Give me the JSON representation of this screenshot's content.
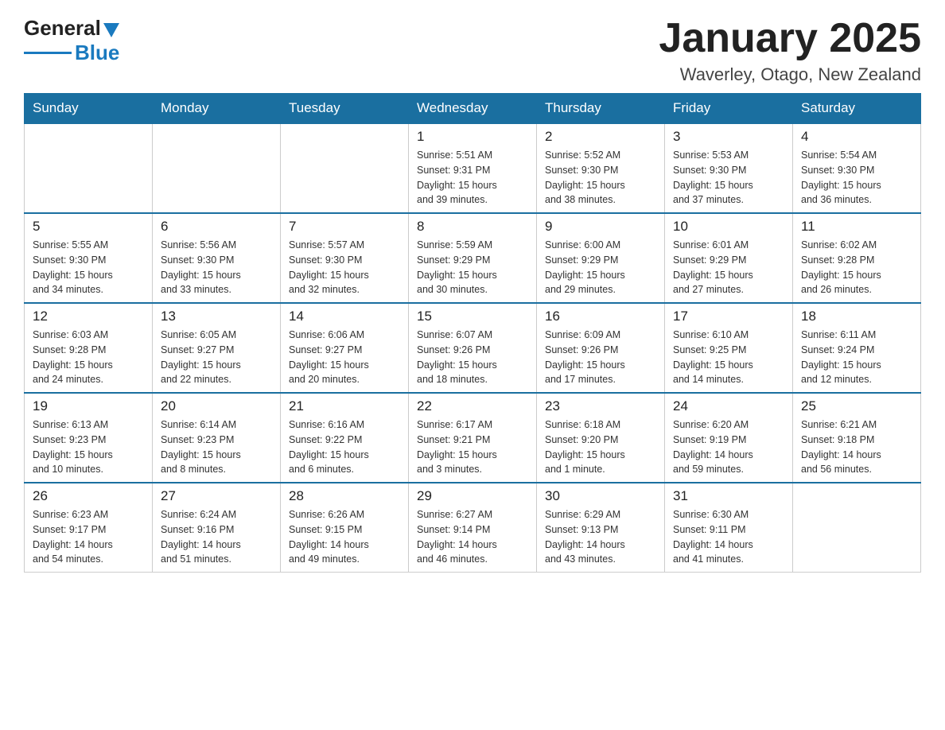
{
  "logo": {
    "general": "General",
    "blue": "Blue"
  },
  "title": "January 2025",
  "subtitle": "Waverley, Otago, New Zealand",
  "weekdays": [
    "Sunday",
    "Monday",
    "Tuesday",
    "Wednesday",
    "Thursday",
    "Friday",
    "Saturday"
  ],
  "weeks": [
    [
      {
        "day": "",
        "info": ""
      },
      {
        "day": "",
        "info": ""
      },
      {
        "day": "",
        "info": ""
      },
      {
        "day": "1",
        "info": "Sunrise: 5:51 AM\nSunset: 9:31 PM\nDaylight: 15 hours\nand 39 minutes."
      },
      {
        "day": "2",
        "info": "Sunrise: 5:52 AM\nSunset: 9:30 PM\nDaylight: 15 hours\nand 38 minutes."
      },
      {
        "day": "3",
        "info": "Sunrise: 5:53 AM\nSunset: 9:30 PM\nDaylight: 15 hours\nand 37 minutes."
      },
      {
        "day": "4",
        "info": "Sunrise: 5:54 AM\nSunset: 9:30 PM\nDaylight: 15 hours\nand 36 minutes."
      }
    ],
    [
      {
        "day": "5",
        "info": "Sunrise: 5:55 AM\nSunset: 9:30 PM\nDaylight: 15 hours\nand 34 minutes."
      },
      {
        "day": "6",
        "info": "Sunrise: 5:56 AM\nSunset: 9:30 PM\nDaylight: 15 hours\nand 33 minutes."
      },
      {
        "day": "7",
        "info": "Sunrise: 5:57 AM\nSunset: 9:30 PM\nDaylight: 15 hours\nand 32 minutes."
      },
      {
        "day": "8",
        "info": "Sunrise: 5:59 AM\nSunset: 9:29 PM\nDaylight: 15 hours\nand 30 minutes."
      },
      {
        "day": "9",
        "info": "Sunrise: 6:00 AM\nSunset: 9:29 PM\nDaylight: 15 hours\nand 29 minutes."
      },
      {
        "day": "10",
        "info": "Sunrise: 6:01 AM\nSunset: 9:29 PM\nDaylight: 15 hours\nand 27 minutes."
      },
      {
        "day": "11",
        "info": "Sunrise: 6:02 AM\nSunset: 9:28 PM\nDaylight: 15 hours\nand 26 minutes."
      }
    ],
    [
      {
        "day": "12",
        "info": "Sunrise: 6:03 AM\nSunset: 9:28 PM\nDaylight: 15 hours\nand 24 minutes."
      },
      {
        "day": "13",
        "info": "Sunrise: 6:05 AM\nSunset: 9:27 PM\nDaylight: 15 hours\nand 22 minutes."
      },
      {
        "day": "14",
        "info": "Sunrise: 6:06 AM\nSunset: 9:27 PM\nDaylight: 15 hours\nand 20 minutes."
      },
      {
        "day": "15",
        "info": "Sunrise: 6:07 AM\nSunset: 9:26 PM\nDaylight: 15 hours\nand 18 minutes."
      },
      {
        "day": "16",
        "info": "Sunrise: 6:09 AM\nSunset: 9:26 PM\nDaylight: 15 hours\nand 17 minutes."
      },
      {
        "day": "17",
        "info": "Sunrise: 6:10 AM\nSunset: 9:25 PM\nDaylight: 15 hours\nand 14 minutes."
      },
      {
        "day": "18",
        "info": "Sunrise: 6:11 AM\nSunset: 9:24 PM\nDaylight: 15 hours\nand 12 minutes."
      }
    ],
    [
      {
        "day": "19",
        "info": "Sunrise: 6:13 AM\nSunset: 9:23 PM\nDaylight: 15 hours\nand 10 minutes."
      },
      {
        "day": "20",
        "info": "Sunrise: 6:14 AM\nSunset: 9:23 PM\nDaylight: 15 hours\nand 8 minutes."
      },
      {
        "day": "21",
        "info": "Sunrise: 6:16 AM\nSunset: 9:22 PM\nDaylight: 15 hours\nand 6 minutes."
      },
      {
        "day": "22",
        "info": "Sunrise: 6:17 AM\nSunset: 9:21 PM\nDaylight: 15 hours\nand 3 minutes."
      },
      {
        "day": "23",
        "info": "Sunrise: 6:18 AM\nSunset: 9:20 PM\nDaylight: 15 hours\nand 1 minute."
      },
      {
        "day": "24",
        "info": "Sunrise: 6:20 AM\nSunset: 9:19 PM\nDaylight: 14 hours\nand 59 minutes."
      },
      {
        "day": "25",
        "info": "Sunrise: 6:21 AM\nSunset: 9:18 PM\nDaylight: 14 hours\nand 56 minutes."
      }
    ],
    [
      {
        "day": "26",
        "info": "Sunrise: 6:23 AM\nSunset: 9:17 PM\nDaylight: 14 hours\nand 54 minutes."
      },
      {
        "day": "27",
        "info": "Sunrise: 6:24 AM\nSunset: 9:16 PM\nDaylight: 14 hours\nand 51 minutes."
      },
      {
        "day": "28",
        "info": "Sunrise: 6:26 AM\nSunset: 9:15 PM\nDaylight: 14 hours\nand 49 minutes."
      },
      {
        "day": "29",
        "info": "Sunrise: 6:27 AM\nSunset: 9:14 PM\nDaylight: 14 hours\nand 46 minutes."
      },
      {
        "day": "30",
        "info": "Sunrise: 6:29 AM\nSunset: 9:13 PM\nDaylight: 14 hours\nand 43 minutes."
      },
      {
        "day": "31",
        "info": "Sunrise: 6:30 AM\nSunset: 9:11 PM\nDaylight: 14 hours\nand 41 minutes."
      },
      {
        "day": "",
        "info": ""
      }
    ]
  ]
}
